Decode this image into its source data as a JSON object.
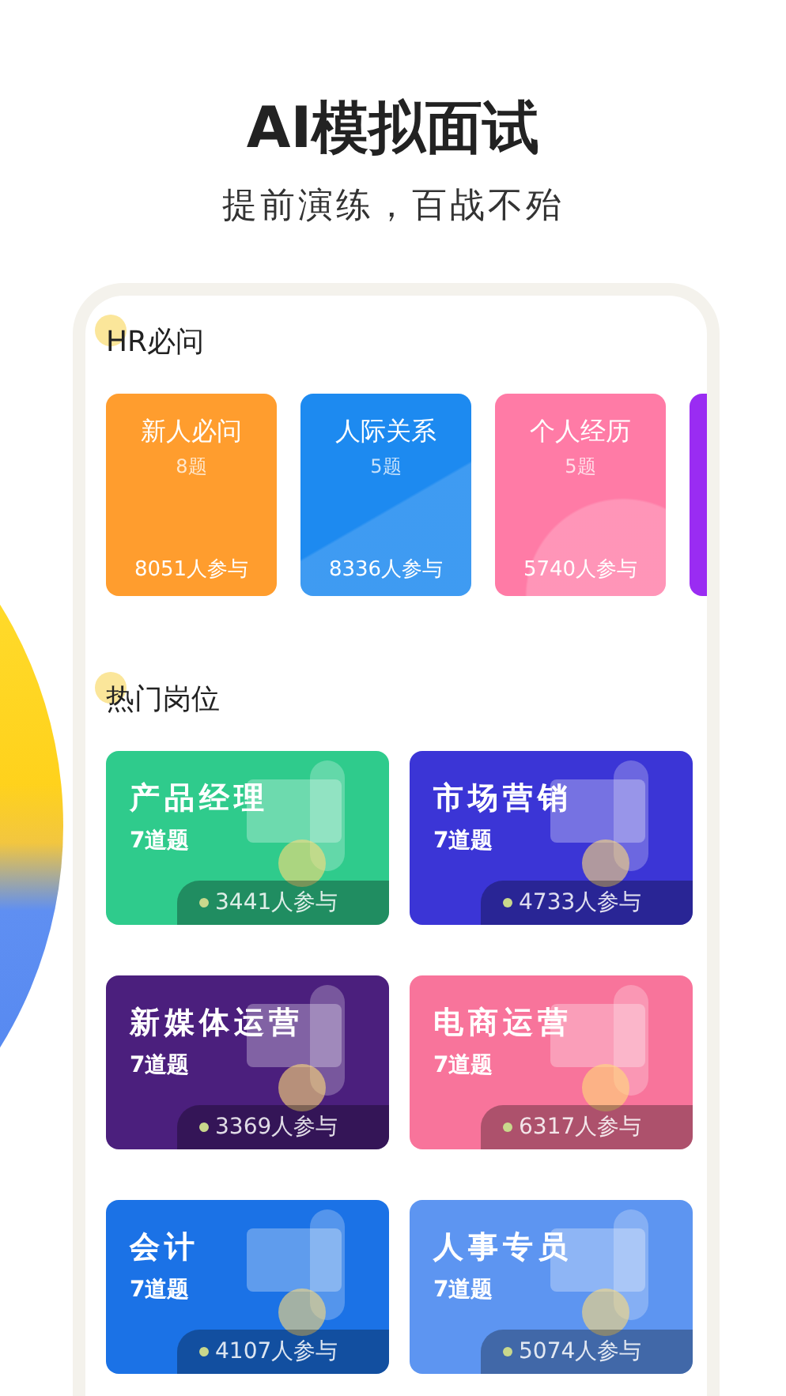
{
  "header": {
    "title": "AI模拟面试",
    "subtitle": "提前演练，百战不殆"
  },
  "hr_section": {
    "title": "HR必问",
    "cards": [
      {
        "title": "新人必问",
        "count": "8题",
        "participants": "8051人参与",
        "color": "#ff9d2e"
      },
      {
        "title": "人际关系",
        "count": "5题",
        "participants": "8336人参与",
        "color": "#1d8af0"
      },
      {
        "title": "个人经历",
        "count": "5题",
        "participants": "5740人参与",
        "color": "#ff7ba6"
      },
      {
        "color": "#9a2cf2"
      }
    ]
  },
  "jobs_section": {
    "title": "热门岗位",
    "cards": [
      {
        "title": "产品经理",
        "count": "7道题",
        "participants": "3441人参与",
        "color": "#2fcb8c"
      },
      {
        "title": "市场营销",
        "count": "7道题",
        "participants": "4733人参与",
        "color": "#3b35d6"
      },
      {
        "title": "新媒体运营",
        "count": "7道题",
        "participants": "3369人参与",
        "color": "#4b1f7d"
      },
      {
        "title": "电商运营",
        "count": "7道题",
        "participants": "6317人参与",
        "color": "#f8749b"
      },
      {
        "title": "会计",
        "count": "7道题",
        "participants": "4107人参与",
        "color": "#1b72e6"
      },
      {
        "title": "人事专员",
        "count": "7道题",
        "participants": "5074人参与",
        "color": "#5d95f1"
      }
    ]
  }
}
